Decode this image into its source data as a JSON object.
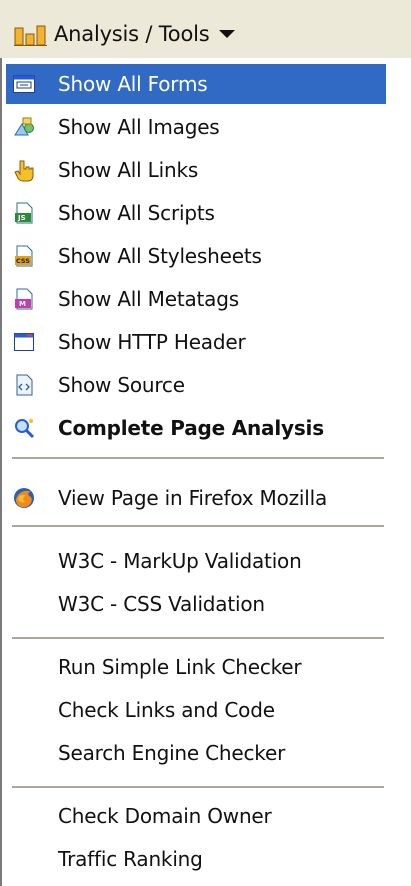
{
  "toolbar": {
    "title": "Analysis / Tools",
    "icon": "bar-chart-icon"
  },
  "menu": {
    "selected_index": 0,
    "groups": [
      {
        "items": [
          {
            "label": "Show All Forms",
            "icon": "form-icon"
          },
          {
            "label": "Show All Images",
            "icon": "images-icon"
          },
          {
            "label": "Show All Links",
            "icon": "hand-pointer-icon"
          },
          {
            "label": "Show All Scripts",
            "icon": "js-file-icon"
          },
          {
            "label": "Show All Stylesheets",
            "icon": "css-file-icon"
          },
          {
            "label": "Show All Metatags",
            "icon": "meta-file-icon"
          },
          {
            "label": "Show HTTP Header",
            "icon": "http-header-icon"
          },
          {
            "label": "Show Source",
            "icon": "source-file-icon"
          },
          {
            "label": "Complete Page Analysis",
            "icon": "magnifier-icon"
          }
        ]
      },
      {
        "items": [
          {
            "label": "View Page in Firefox Mozilla",
            "icon": "firefox-icon"
          }
        ]
      },
      {
        "items": [
          {
            "label": "W3C - MarkUp Validation"
          },
          {
            "label": "W3C - CSS Validation"
          }
        ]
      },
      {
        "items": [
          {
            "label": "Run Simple Link Checker"
          },
          {
            "label": "Check Links and Code"
          },
          {
            "label": "Search Engine Checker"
          }
        ]
      },
      {
        "items": [
          {
            "label": "Check Domain Owner"
          },
          {
            "label": "Traffic Ranking"
          }
        ]
      }
    ]
  },
  "colors": {
    "selection": "#316ac5",
    "toolbar_bg": "#ece9d8",
    "separator": "#aca899"
  }
}
